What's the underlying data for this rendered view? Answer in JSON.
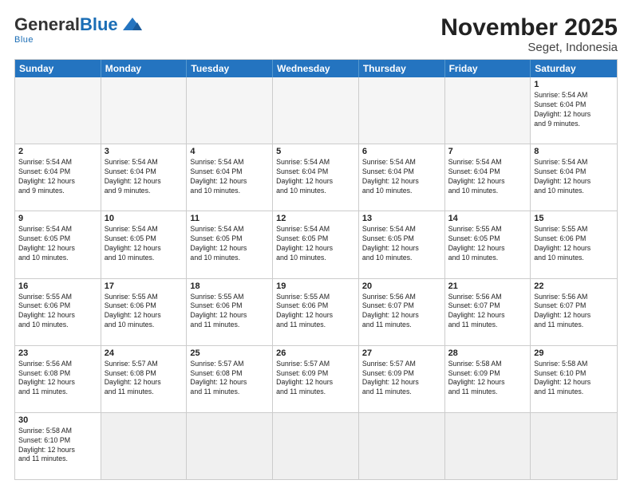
{
  "logo": {
    "general": "General",
    "blue": "Blue",
    "tagline": "Blue"
  },
  "title": "November 2025",
  "subtitle": "Seget, Indonesia",
  "header_days": [
    "Sunday",
    "Monday",
    "Tuesday",
    "Wednesday",
    "Thursday",
    "Friday",
    "Saturday"
  ],
  "weeks": [
    [
      {
        "day": "",
        "empty": true,
        "info": ""
      },
      {
        "day": "",
        "empty": true,
        "info": ""
      },
      {
        "day": "",
        "empty": true,
        "info": ""
      },
      {
        "day": "",
        "empty": true,
        "info": ""
      },
      {
        "day": "",
        "empty": true,
        "info": ""
      },
      {
        "day": "",
        "empty": true,
        "info": ""
      },
      {
        "day": "1",
        "empty": false,
        "info": "Sunrise: 5:54 AM\nSunset: 6:04 PM\nDaylight: 12 hours\nand 9 minutes."
      }
    ],
    [
      {
        "day": "2",
        "empty": false,
        "info": "Sunrise: 5:54 AM\nSunset: 6:04 PM\nDaylight: 12 hours\nand 9 minutes."
      },
      {
        "day": "3",
        "empty": false,
        "info": "Sunrise: 5:54 AM\nSunset: 6:04 PM\nDaylight: 12 hours\nand 9 minutes."
      },
      {
        "day": "4",
        "empty": false,
        "info": "Sunrise: 5:54 AM\nSunset: 6:04 PM\nDaylight: 12 hours\nand 10 minutes."
      },
      {
        "day": "5",
        "empty": false,
        "info": "Sunrise: 5:54 AM\nSunset: 6:04 PM\nDaylight: 12 hours\nand 10 minutes."
      },
      {
        "day": "6",
        "empty": false,
        "info": "Sunrise: 5:54 AM\nSunset: 6:04 PM\nDaylight: 12 hours\nand 10 minutes."
      },
      {
        "day": "7",
        "empty": false,
        "info": "Sunrise: 5:54 AM\nSunset: 6:04 PM\nDaylight: 12 hours\nand 10 minutes."
      },
      {
        "day": "8",
        "empty": false,
        "info": "Sunrise: 5:54 AM\nSunset: 6:04 PM\nDaylight: 12 hours\nand 10 minutes."
      }
    ],
    [
      {
        "day": "9",
        "empty": false,
        "info": "Sunrise: 5:54 AM\nSunset: 6:05 PM\nDaylight: 12 hours\nand 10 minutes."
      },
      {
        "day": "10",
        "empty": false,
        "info": "Sunrise: 5:54 AM\nSunset: 6:05 PM\nDaylight: 12 hours\nand 10 minutes."
      },
      {
        "day": "11",
        "empty": false,
        "info": "Sunrise: 5:54 AM\nSunset: 6:05 PM\nDaylight: 12 hours\nand 10 minutes."
      },
      {
        "day": "12",
        "empty": false,
        "info": "Sunrise: 5:54 AM\nSunset: 6:05 PM\nDaylight: 12 hours\nand 10 minutes."
      },
      {
        "day": "13",
        "empty": false,
        "info": "Sunrise: 5:54 AM\nSunset: 6:05 PM\nDaylight: 12 hours\nand 10 minutes."
      },
      {
        "day": "14",
        "empty": false,
        "info": "Sunrise: 5:55 AM\nSunset: 6:05 PM\nDaylight: 12 hours\nand 10 minutes."
      },
      {
        "day": "15",
        "empty": false,
        "info": "Sunrise: 5:55 AM\nSunset: 6:06 PM\nDaylight: 12 hours\nand 10 minutes."
      }
    ],
    [
      {
        "day": "16",
        "empty": false,
        "info": "Sunrise: 5:55 AM\nSunset: 6:06 PM\nDaylight: 12 hours\nand 10 minutes."
      },
      {
        "day": "17",
        "empty": false,
        "info": "Sunrise: 5:55 AM\nSunset: 6:06 PM\nDaylight: 12 hours\nand 10 minutes."
      },
      {
        "day": "18",
        "empty": false,
        "info": "Sunrise: 5:55 AM\nSunset: 6:06 PM\nDaylight: 12 hours\nand 11 minutes."
      },
      {
        "day": "19",
        "empty": false,
        "info": "Sunrise: 5:55 AM\nSunset: 6:06 PM\nDaylight: 12 hours\nand 11 minutes."
      },
      {
        "day": "20",
        "empty": false,
        "info": "Sunrise: 5:56 AM\nSunset: 6:07 PM\nDaylight: 12 hours\nand 11 minutes."
      },
      {
        "day": "21",
        "empty": false,
        "info": "Sunrise: 5:56 AM\nSunset: 6:07 PM\nDaylight: 12 hours\nand 11 minutes."
      },
      {
        "day": "22",
        "empty": false,
        "info": "Sunrise: 5:56 AM\nSunset: 6:07 PM\nDaylight: 12 hours\nand 11 minutes."
      }
    ],
    [
      {
        "day": "23",
        "empty": false,
        "info": "Sunrise: 5:56 AM\nSunset: 6:08 PM\nDaylight: 12 hours\nand 11 minutes."
      },
      {
        "day": "24",
        "empty": false,
        "info": "Sunrise: 5:57 AM\nSunset: 6:08 PM\nDaylight: 12 hours\nand 11 minutes."
      },
      {
        "day": "25",
        "empty": false,
        "info": "Sunrise: 5:57 AM\nSunset: 6:08 PM\nDaylight: 12 hours\nand 11 minutes."
      },
      {
        "day": "26",
        "empty": false,
        "info": "Sunrise: 5:57 AM\nSunset: 6:09 PM\nDaylight: 12 hours\nand 11 minutes."
      },
      {
        "day": "27",
        "empty": false,
        "info": "Sunrise: 5:57 AM\nSunset: 6:09 PM\nDaylight: 12 hours\nand 11 minutes."
      },
      {
        "day": "28",
        "empty": false,
        "info": "Sunrise: 5:58 AM\nSunset: 6:09 PM\nDaylight: 12 hours\nand 11 minutes."
      },
      {
        "day": "29",
        "empty": false,
        "info": "Sunrise: 5:58 AM\nSunset: 6:10 PM\nDaylight: 12 hours\nand 11 minutes."
      }
    ],
    [
      {
        "day": "30",
        "empty": false,
        "info": "Sunrise: 5:58 AM\nSunset: 6:10 PM\nDaylight: 12 hours\nand 11 minutes."
      },
      {
        "day": "",
        "empty": true,
        "info": ""
      },
      {
        "day": "",
        "empty": true,
        "info": ""
      },
      {
        "day": "",
        "empty": true,
        "info": ""
      },
      {
        "day": "",
        "empty": true,
        "info": ""
      },
      {
        "day": "",
        "empty": true,
        "info": ""
      },
      {
        "day": "",
        "empty": true,
        "info": ""
      }
    ]
  ]
}
